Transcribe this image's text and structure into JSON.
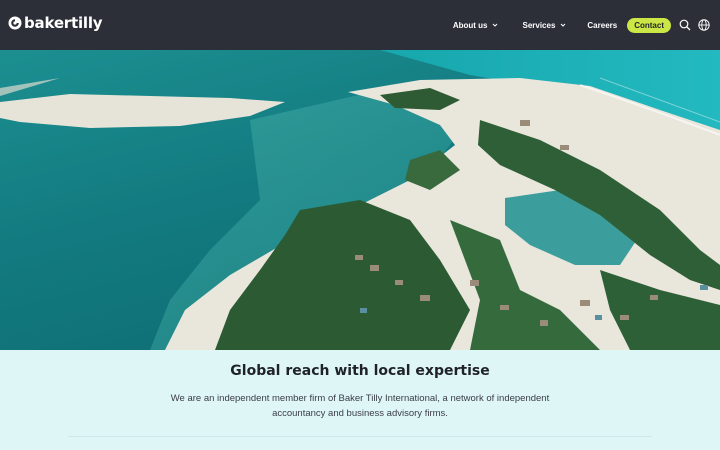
{
  "brand": {
    "name": "bakertilly",
    "accent_color": "#cce645",
    "header_bg": "#2d2f38",
    "section_bg": "#dff6f7"
  },
  "nav": {
    "items": [
      {
        "label": "About us",
        "has_dropdown": true
      },
      {
        "label": "Services",
        "has_dropdown": true
      },
      {
        "label": "Careers",
        "has_dropdown": false
      }
    ],
    "contact_label": "Contact",
    "icons": [
      "search-icon",
      "globe-icon",
      "chevron-down-icon"
    ]
  },
  "intro": {
    "title": "Global reach with local expertise",
    "text": "We are an independent member firm of Baker Tilly International, a network of independent accountancy and business advisory firms."
  }
}
